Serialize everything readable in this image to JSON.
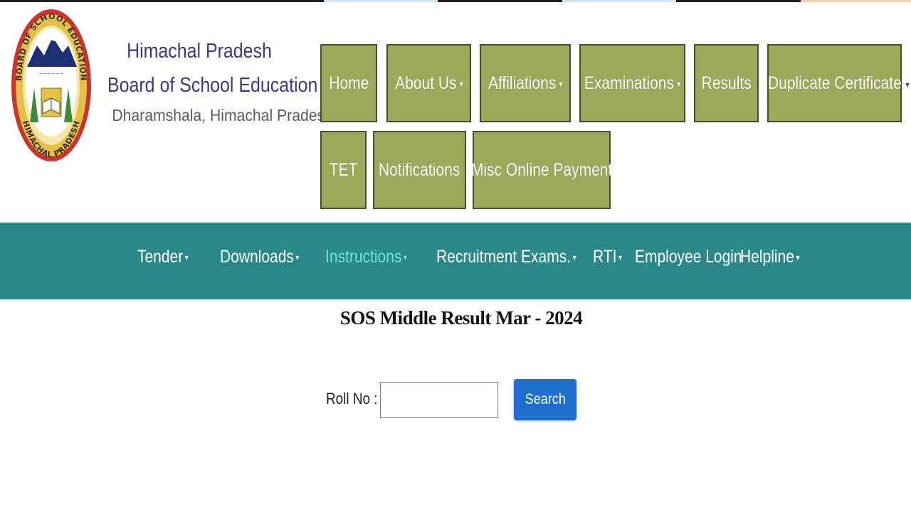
{
  "logo": {
    "ring_top_text": "BOARD OF SCHOOL EDUCATION",
    "ring_bottom_text": "HIMACHAL PRADESH",
    "colors": {
      "ring": "#c9342d",
      "gold": "#e3c046",
      "navy": "#1e2f73",
      "tree": "#3f8a3a"
    }
  },
  "header": {
    "org_line1": "Himachal Pradesh",
    "org_line2": "Board of School Education",
    "org_line3": "Dharamshala, Himachal Pradesh"
  },
  "nav_main": [
    {
      "label": "Home",
      "has_dropdown": false
    },
    {
      "label": "About Us",
      "has_dropdown": true
    },
    {
      "label": "Affiliations",
      "has_dropdown": true
    },
    {
      "label": "Examinations",
      "has_dropdown": true
    },
    {
      "label": "Results",
      "has_dropdown": false
    },
    {
      "label": "Duplicate Certificate",
      "has_dropdown": false
    },
    {
      "label": "TET",
      "has_dropdown": false
    },
    {
      "label": "Notifications",
      "has_dropdown": false
    },
    {
      "label": "Misc Online Payment",
      "has_dropdown": false
    }
  ],
  "nav_secondary": [
    {
      "label": "Tender",
      "has_dropdown": true,
      "active": false
    },
    {
      "label": "Downloads",
      "has_dropdown": true,
      "active": false
    },
    {
      "label": "Instructions",
      "has_dropdown": true,
      "active": true
    },
    {
      "label": "Recruitment Exams.",
      "has_dropdown": true,
      "active": false
    },
    {
      "label": "RTI",
      "has_dropdown": true,
      "active": false
    },
    {
      "label": "Employee Login",
      "has_dropdown": false,
      "active": false
    },
    {
      "label": "Helpline",
      "has_dropdown": true,
      "active": false
    }
  ],
  "caret_glyph": "▾",
  "page_title": "SOS Middle Result Mar - 2024",
  "form": {
    "roll_label": "Roll No :",
    "roll_value": "",
    "search_label": "Search"
  },
  "colors": {
    "olive_button": "#9da85a",
    "teal_bar": "#2b8888",
    "active_link": "#6fe6c8",
    "search_button": "#1f6fd0",
    "org_text": "#3b3a80"
  }
}
